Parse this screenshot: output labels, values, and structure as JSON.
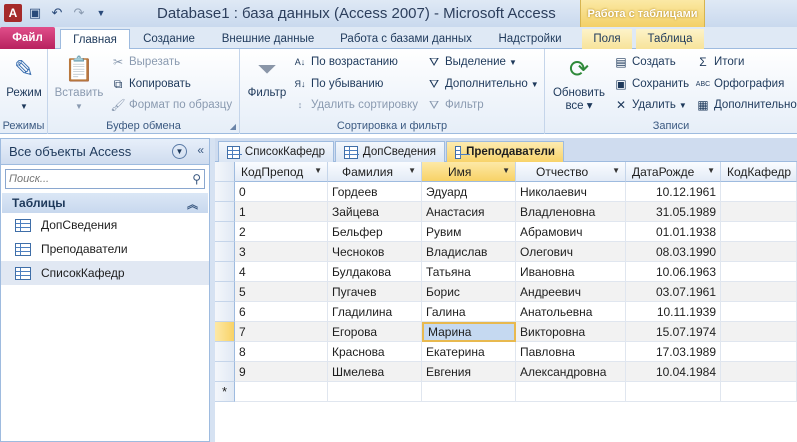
{
  "window": {
    "title": "Database1 : база данных (Access 2007)  -  Microsoft Access",
    "context_group": "Работа с таблицами",
    "app_icon_letter": "A"
  },
  "tabs": [
    {
      "label": "Файл",
      "id": "file"
    },
    {
      "label": "Главная",
      "id": "home"
    },
    {
      "label": "Создание",
      "id": "create"
    },
    {
      "label": "Внешние данные",
      "id": "external"
    },
    {
      "label": "Работа с базами данных",
      "id": "dbtools"
    },
    {
      "label": "Надстройки",
      "id": "addins"
    },
    {
      "label": "Поля",
      "id": "fields"
    },
    {
      "label": "Таблица",
      "id": "table"
    }
  ],
  "ribbon": {
    "views": {
      "label": "Режимы",
      "mode": "Режим"
    },
    "clipboard": {
      "label": "Буфер обмена",
      "paste": "Вставить",
      "cut": "Вырезать",
      "copy": "Копировать",
      "format_painter": "Формат по образцу"
    },
    "sort": {
      "label": "Сортировка и фильтр",
      "filter": "Фильтр",
      "asc": "По возрастанию",
      "desc": "По убыванию",
      "remove_sort": "Удалить сортировку",
      "selection": "Выделение",
      "advanced": "Дополнительно",
      "toggle_filter": "Фильтр"
    },
    "records": {
      "label": "Записи",
      "refresh": "Обновить",
      "refresh2": "все",
      "new": "Создать",
      "save": "Сохранить",
      "delete": "Удалить",
      "totals": "Итоги",
      "spelling": "Орфография",
      "more": "Дополнительно"
    }
  },
  "nav": {
    "header": "Все объекты Access",
    "search_placeholder": "Поиск...",
    "section": "Таблицы",
    "items": [
      {
        "label": "ДопСведения"
      },
      {
        "label": "Преподаватели"
      },
      {
        "label": "СписокКафедр"
      }
    ]
  },
  "doc_tabs": [
    {
      "label": "СписокКафедр"
    },
    {
      "label": "ДопСведения"
    },
    {
      "label": "Преподаватели"
    }
  ],
  "table": {
    "columns": [
      "КодПрепод",
      "Фамилия",
      "Имя",
      "Отчество",
      "ДатаРожде",
      "КодКафедр"
    ],
    "rows": [
      [
        "0",
        "Гордеев",
        "Эдуард",
        "Николаевич",
        "10.12.1961"
      ],
      [
        "1",
        "Зайцева",
        "Анастасия",
        "Владленовна",
        "31.05.1989"
      ],
      [
        "2",
        "Бельфер",
        "Рувим",
        "Абрамович",
        "01.01.1938"
      ],
      [
        "3",
        "Чесноков",
        "Владислав",
        "Олегович",
        "08.03.1990"
      ],
      [
        "4",
        "Булдакова",
        "Татьяна",
        "Ивановна",
        "10.06.1963"
      ],
      [
        "5",
        "Пугачев",
        "Борис",
        "Андреевич",
        "03.07.1961"
      ],
      [
        "6",
        "Гладилина",
        "Галина",
        "Анатольевна",
        "10.11.1939"
      ],
      [
        "7",
        "Егорова",
        "Марина",
        "Викторовна",
        "15.07.1974"
      ],
      [
        "8",
        "Краснова",
        "Екатерина",
        "Павловна",
        "17.03.1989"
      ],
      [
        "9",
        "Шмелева",
        "Евгения",
        "Александровна",
        "10.04.1984"
      ]
    ],
    "new_row_marker": "*"
  }
}
